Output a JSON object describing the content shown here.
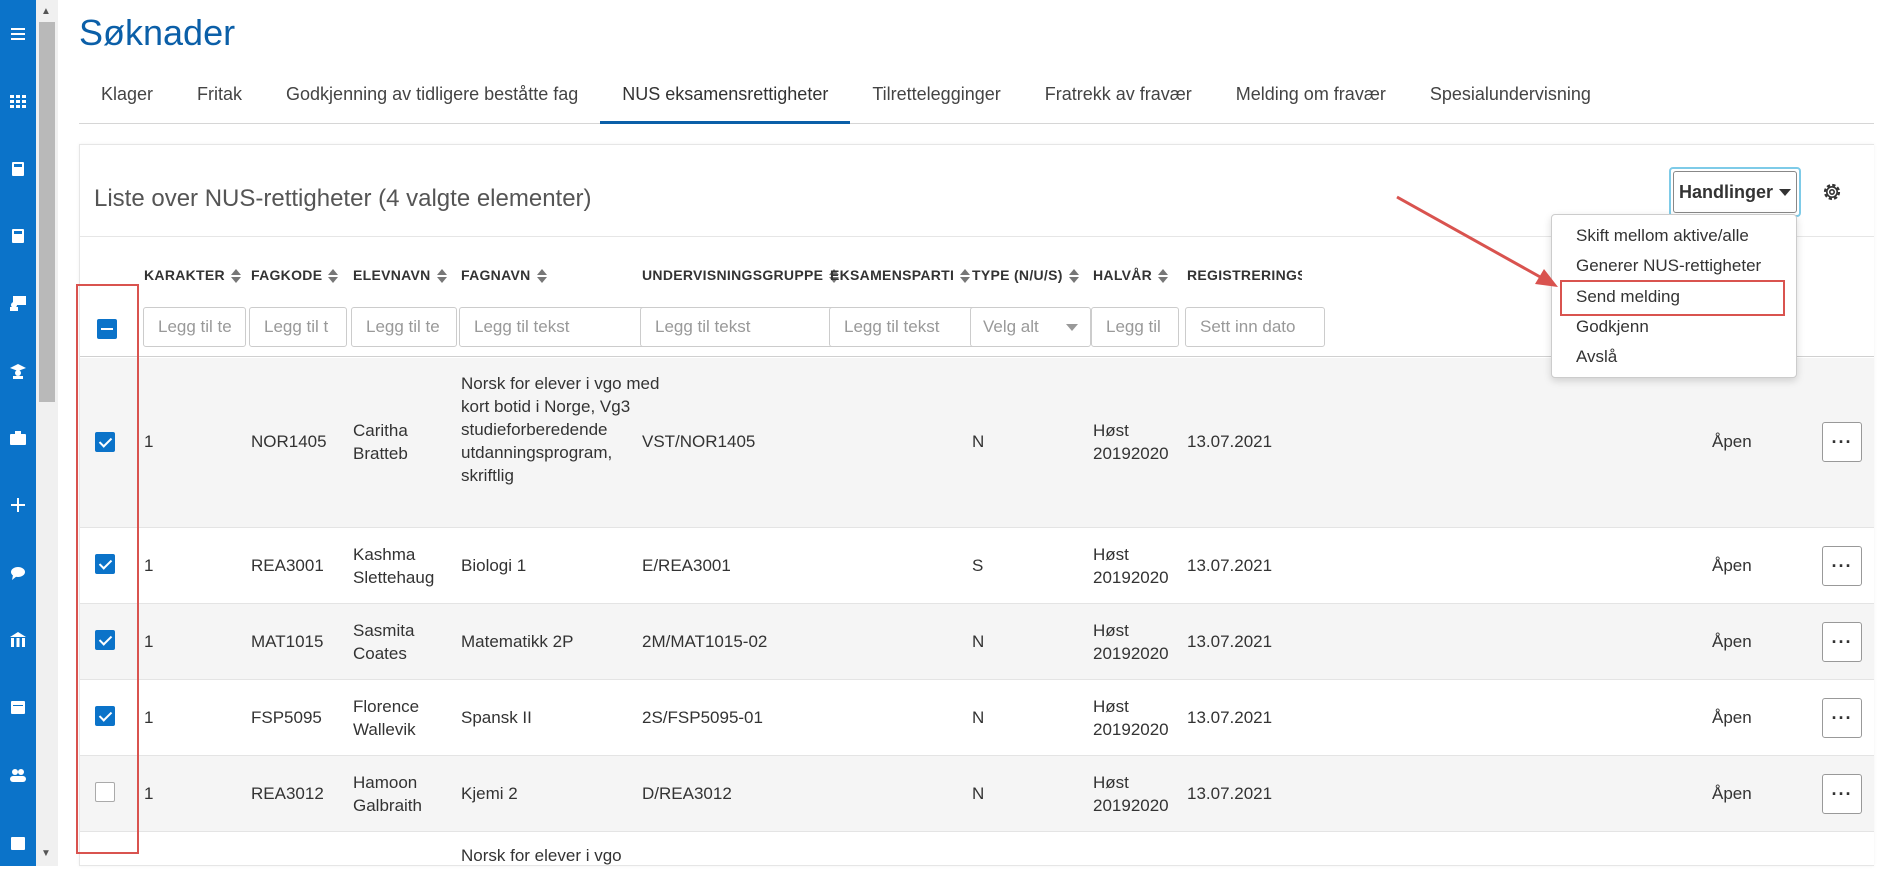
{
  "page": {
    "title": "Søknader"
  },
  "sidebar": {
    "icons": [
      "menu-icon",
      "apps-grid-icon",
      "book-icon",
      "book-open-icon",
      "teacher-icon",
      "student-icon",
      "briefcase-icon",
      "plus-icon",
      "chat-icon",
      "school-icon",
      "calendar-icon",
      "users-icon",
      "calendar-check-icon"
    ]
  },
  "tabs": [
    {
      "label": "Klager",
      "active": false
    },
    {
      "label": "Fritak",
      "active": false
    },
    {
      "label": "Godkjenning av tidligere beståtte fag",
      "active": false
    },
    {
      "label": "NUS eksamensrettigheter",
      "active": true
    },
    {
      "label": "Tilrettelegginger",
      "active": false
    },
    {
      "label": "Fratrekk av fravær",
      "active": false
    },
    {
      "label": "Melding om fravær",
      "active": false
    },
    {
      "label": "Spesialundervisning",
      "active": false
    }
  ],
  "panel": {
    "title": "Liste over NUS-rettigheter (4 valgte elementer)",
    "actions_label": "Handlinger"
  },
  "columns": {
    "karakter": "KARAKTER",
    "fagkode": "FAGKODE",
    "elevnavn": "ELEVNAVN",
    "fagnavn": "FAGNAVN",
    "undervisningsgruppe": "UNDERVISNINGSGRUPPE",
    "eksamensparti": "EKSAMENSPARTI",
    "type": "TYPE (N/U/S)",
    "halvar": "HALVÅR",
    "registreringsdato": "REGISTRERINGSDAT"
  },
  "filters": {
    "karakter": "Legg til te",
    "fagkode": "Legg til t",
    "elevnavn": "Legg til te",
    "fagnavn": "Legg til tekst",
    "undervisningsgruppe": "Legg til tekst",
    "eksamensparti": "Legg til tekst",
    "type": "Velg alt",
    "halvar": "Legg til",
    "registreringsdato": "Sett inn dato"
  },
  "rows": [
    {
      "checked": true,
      "karakter": "1",
      "fagkode": "NOR1405",
      "elevnavn": "Caritha Bratteb",
      "fagnavn": "Norsk for elever i vgo med kort botid i Norge, Vg3 studieforberedende utdanningsprogram, skriftlig",
      "gruppe": "VST/NOR1405",
      "type": "N",
      "halvar": "Høst 20192020",
      "dato": "13.07.2021",
      "status": "Åpen"
    },
    {
      "checked": true,
      "karakter": "1",
      "fagkode": "REA3001",
      "elevnavn": "Kashma Slettehaug",
      "fagnavn": "Biologi 1",
      "gruppe": "E/REA3001",
      "type": "S",
      "halvar": "Høst 20192020",
      "dato": "13.07.2021",
      "status": "Åpen"
    },
    {
      "checked": true,
      "karakter": "1",
      "fagkode": "MAT1015",
      "elevnavn": "Sasmita Coates",
      "fagnavn": "Matematikk 2P",
      "gruppe": "2M/MAT1015-02",
      "type": "N",
      "halvar": "Høst 20192020",
      "dato": "13.07.2021",
      "status": "Åpen"
    },
    {
      "checked": true,
      "karakter": "1",
      "fagkode": "FSP5095",
      "elevnavn": "Florence Wallevik",
      "fagnavn": "Spansk II",
      "gruppe": "2S/FSP5095-01",
      "type": "N",
      "halvar": "Høst 20192020",
      "dato": "13.07.2021",
      "status": "Åpen"
    },
    {
      "checked": false,
      "karakter": "1",
      "fagkode": "REA3012",
      "elevnavn": "Hamoon Galbraith",
      "fagnavn": "Kjemi 2",
      "gruppe": "D/REA3012",
      "type": "N",
      "halvar": "Høst 20192020",
      "dato": "13.07.2021",
      "status": "Åpen"
    },
    {
      "partial": "Norsk for elever i vgo"
    }
  ],
  "dropdown": {
    "items": [
      "Skift mellom aktive/alle",
      "Generer NUS-rettigheter",
      "Send melding",
      "Godkjenn",
      "Avslå"
    ],
    "highlighted": "Send melding"
  },
  "colors": {
    "brand": "#0b73c9",
    "title": "#0b5fa8",
    "annotation": "#d9534f"
  }
}
